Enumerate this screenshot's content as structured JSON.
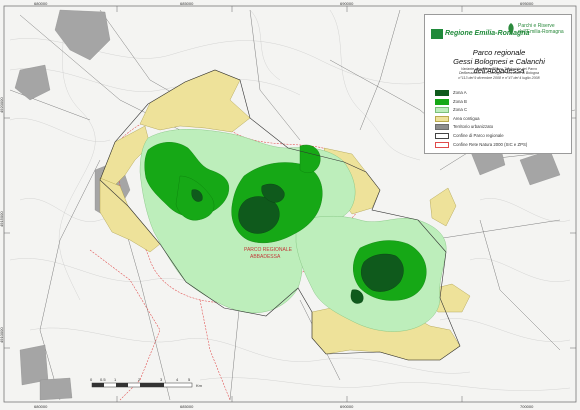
{
  "legend": {
    "logo_left_text": "Regione Emilia-Romagna",
    "logo_right_lines": [
      "Parchi e Riserve",
      "dell'Emilia-Romagna"
    ],
    "title_line1": "Parco regionale",
    "title_line2": "Gessi Bolognesi e Calanchi dell'Abbadessa",
    "subtitle_lines": [
      "Variante generale al Piano Territoriale del Parco",
      "Deliberazione del Consiglio Provinciale di Bologna",
      "n°113 del 9 dicembre 2008 e n°47 del 4 luglio 2008"
    ],
    "items": [
      {
        "label": "Zona A",
        "color": "#0f5a1c",
        "border": "#0f5a1c"
      },
      {
        "label": "Zona B",
        "color": "#16a816",
        "border": "#16a816"
      },
      {
        "label": "Zona C",
        "color": "#bdeebb",
        "border": "#7cbf7a"
      },
      {
        "label": "Area contigua",
        "color": "#eee29a",
        "border": "#b8a94e"
      },
      {
        "label": "Territorio urbanizzato",
        "color": "#8c8c8c",
        "border": "#6c6c6c"
      },
      {
        "label": "Confine di Parco regionale",
        "color": "#ffffff",
        "border": "#444444"
      },
      {
        "label": "Confine Rete Natura 2000 (SIC e ZPS)",
        "color": "#ffffff",
        "border": "#e04a4a"
      }
    ]
  },
  "coords": {
    "top": [
      "680000",
      "685000",
      "690000",
      "695000",
      "700000"
    ],
    "side": [
      "4920000",
      "4915000",
      "4910000"
    ]
  },
  "scale_labels": [
    "0",
    "0.5",
    "1",
    "2",
    "3",
    "4",
    "5",
    "Km"
  ],
  "map_labels": [
    "PARCO REGIONALE",
    "ABBADESSA"
  ],
  "colors": {
    "zone_a": "#0f5a1c",
    "zone_b": "#16a816",
    "zone_c": "#bdeebb",
    "contigua": "#eee29a",
    "urban": "#8c8c8c",
    "natura2000": "#e04a4a"
  }
}
